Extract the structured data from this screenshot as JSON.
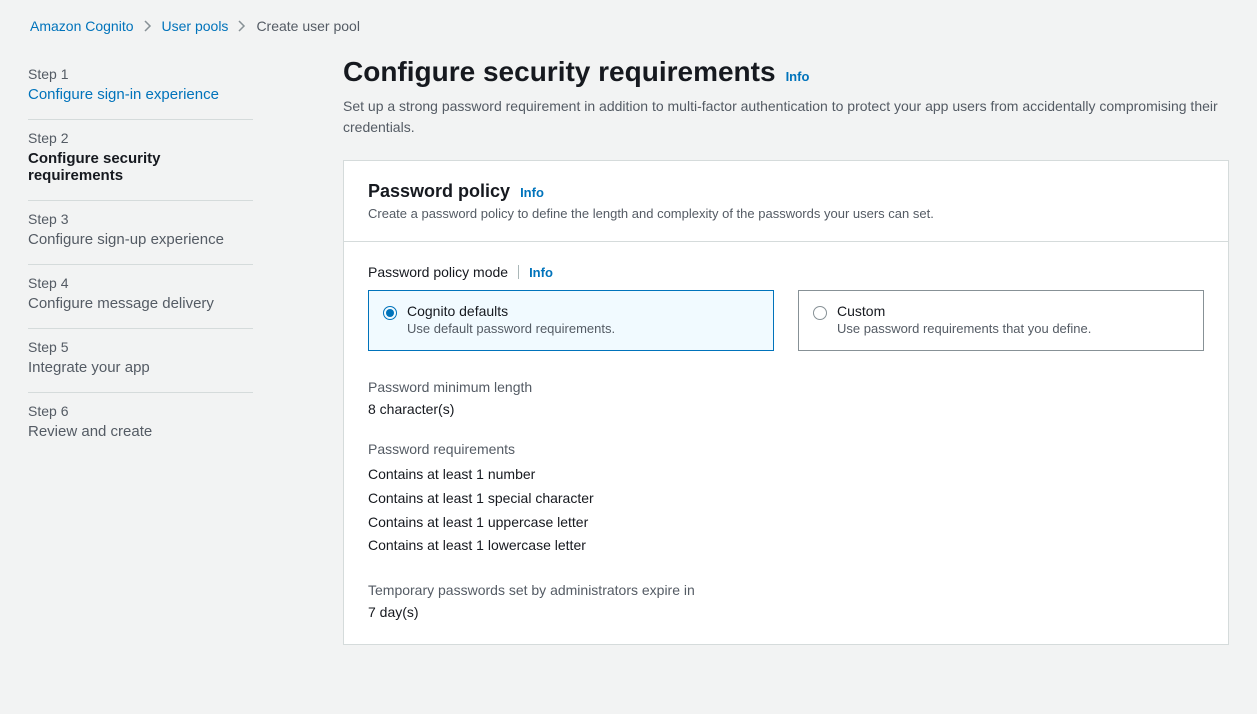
{
  "breadcrumb": {
    "items": [
      {
        "label": "Amazon Cognito",
        "link": true
      },
      {
        "label": "User pools",
        "link": true
      },
      {
        "label": "Create user pool",
        "link": false
      }
    ]
  },
  "steps": [
    {
      "num": "Step 1",
      "title": "Configure sign-in experience",
      "state": "link"
    },
    {
      "num": "Step 2",
      "title": "Configure security requirements",
      "state": "current"
    },
    {
      "num": "Step 3",
      "title": "Configure sign-up experience",
      "state": "future"
    },
    {
      "num": "Step 4",
      "title": "Configure message delivery",
      "state": "future"
    },
    {
      "num": "Step 5",
      "title": "Integrate your app",
      "state": "future"
    },
    {
      "num": "Step 6",
      "title": "Review and create",
      "state": "future"
    }
  ],
  "header": {
    "title": "Configure security requirements",
    "info": "Info",
    "subtitle": "Set up a strong password requirement in addition to multi-factor authentication to protect your app users from accidentally compromising their credentials."
  },
  "panel": {
    "title": "Password policy",
    "info": "Info",
    "desc": "Create a password policy to define the length and complexity of the passwords your users can set."
  },
  "policy_mode": {
    "label": "Password policy mode",
    "info": "Info",
    "options": [
      {
        "title": "Cognito defaults",
        "desc": "Use default password requirements.",
        "selected": true
      },
      {
        "title": "Custom",
        "desc": "Use password requirements that you define.",
        "selected": false
      }
    ]
  },
  "min_length": {
    "label": "Password minimum length",
    "value": "8 character(s)"
  },
  "requirements": {
    "label": "Password requirements",
    "items": [
      "Contains at least 1 number",
      "Contains at least 1 special character",
      "Contains at least 1 uppercase letter",
      "Contains at least 1 lowercase letter"
    ]
  },
  "temp_password": {
    "label": "Temporary passwords set by administrators expire in",
    "value": "7 day(s)"
  }
}
